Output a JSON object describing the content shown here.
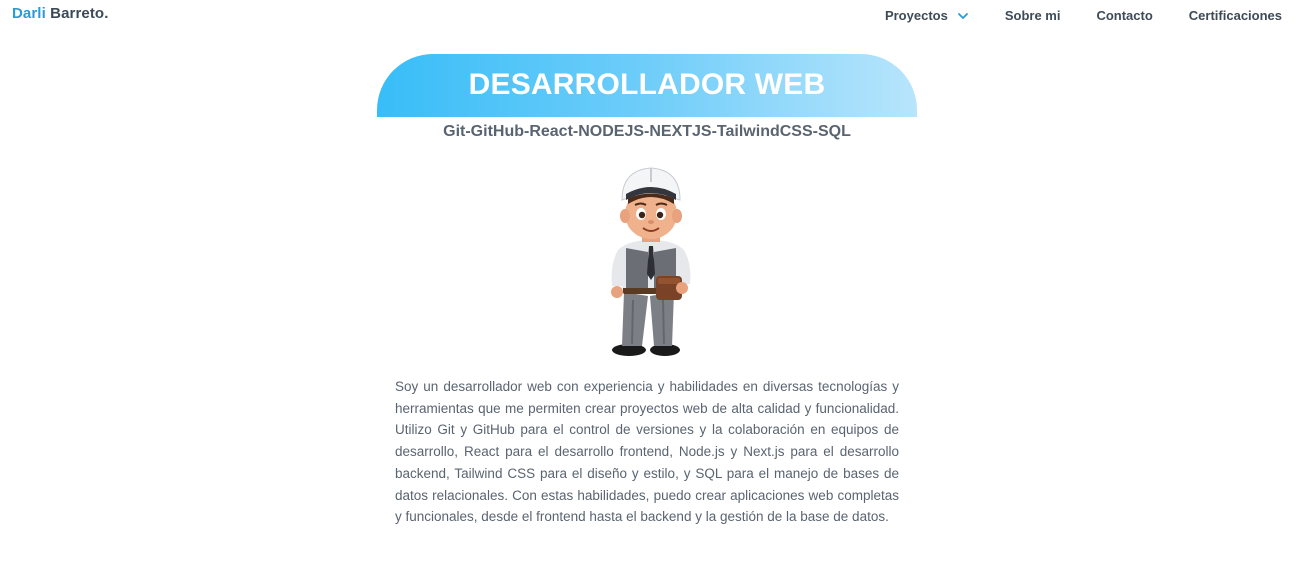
{
  "nav": {
    "brand_first": "Darli",
    "brand_last": "Barreto.",
    "links": [
      {
        "label": "Proyectos",
        "icon": "chevron-down-icon"
      },
      {
        "label": "Sobre mi"
      },
      {
        "label": "Contacto"
      },
      {
        "label": "Certificaciones"
      }
    ]
  },
  "hero": {
    "title": "DESARROLLADOR WEB",
    "subtitle": "Git-GitHub-React-NODEJS-NEXTJS-TailwindCSS-SQL",
    "avatar_icon": "developer-avatar-illustration"
  },
  "bio": "Soy un desarrollador web con experiencia y habilidades en diversas tecnologías y herramientas que me permiten crear proyectos web de alta calidad y funcionalidad. Utilizo Git y GitHub para el control de versiones y la colaboración en equipos de desarrollo, React para el desarrollo frontend, Node.js y Next.js para el desarrollo backend, Tailwind CSS para el diseño y estilo, y SQL para el manejo de bases de datos relacionales. Con estas habilidades, puedo crear aplicaciones web completas y funcionales, desde el frontend hasta el backend y la gestión de la base de datos.",
  "colors": {
    "accent": "#38bdf8",
    "brand_first": "#2b9bd8",
    "text": "#5a6470"
  }
}
